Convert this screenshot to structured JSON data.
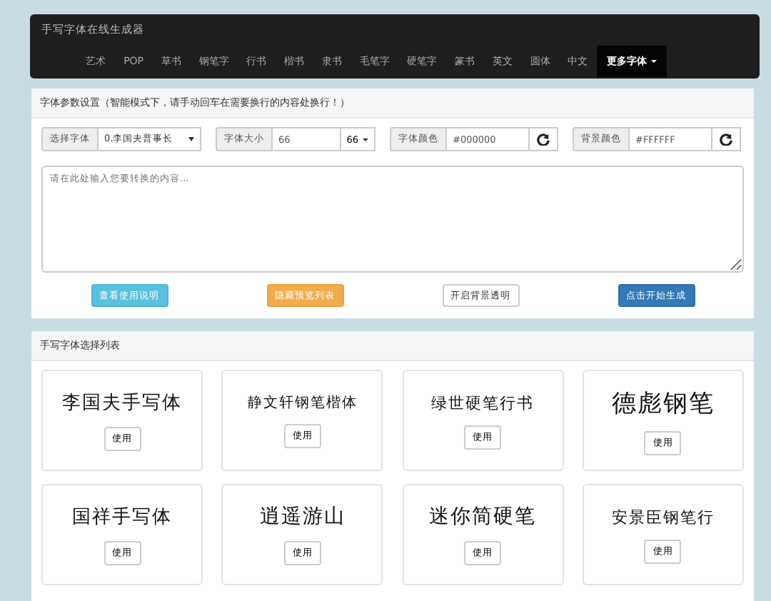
{
  "navbar": {
    "brand": "手写字体在线生成器",
    "items": [
      {
        "label": "艺术",
        "selected": false
      },
      {
        "label": "POP",
        "selected": false
      },
      {
        "label": "草书",
        "selected": false
      },
      {
        "label": "钢笔字",
        "selected": false
      },
      {
        "label": "行书",
        "selected": false
      },
      {
        "label": "楷书",
        "selected": false
      },
      {
        "label": "隶书",
        "selected": false
      },
      {
        "label": "毛笔字",
        "selected": false
      },
      {
        "label": "硬笔字",
        "selected": false
      },
      {
        "label": "篆书",
        "selected": false
      },
      {
        "label": "英文",
        "selected": false
      },
      {
        "label": "圆体",
        "selected": false
      },
      {
        "label": "中文",
        "selected": false
      },
      {
        "label": "更多字体",
        "selected": true
      }
    ]
  },
  "settings": {
    "title": "字体参数设置（智能模式下，请手动回车在需要换行的内容处换行！）",
    "font_label": "选择字体",
    "font_value": "0.李国夫普事长",
    "size_label": "字体大小",
    "size_value": "66",
    "size_dropdown": "66",
    "color_label": "字体颜色",
    "color_value": "#000000",
    "bg_label": "背景颜色",
    "bg_value": "#FFFFFF",
    "text_placeholder": "请在此处输入您要转换的内容...",
    "buttons": [
      {
        "label": "查看使用说明",
        "kind": "info"
      },
      {
        "label": "隐藏预览列表",
        "kind": "warning"
      },
      {
        "label": "开启背景透明",
        "kind": "default"
      },
      {
        "label": "点击开始生成",
        "kind": "primary"
      }
    ]
  },
  "font_list": {
    "title": "手写字体选择列表",
    "fonts": [
      {
        "sample": "李国夫手写体",
        "button": "使用"
      },
      {
        "sample": "静文轩钢笔楷体",
        "button": "使用"
      },
      {
        "sample": "绿世硬笔行书",
        "button": "使用"
      },
      {
        "sample": "德彪钢笔",
        "button": "使用"
      },
      {
        "sample": "国祥手写体",
        "button": "使用"
      },
      {
        "sample": "逍遥游山",
        "button": "使用"
      },
      {
        "sample": "迷你简硬笔",
        "button": "使用"
      },
      {
        "sample": "安景臣钢笔行",
        "button": "使用"
      }
    ]
  }
}
